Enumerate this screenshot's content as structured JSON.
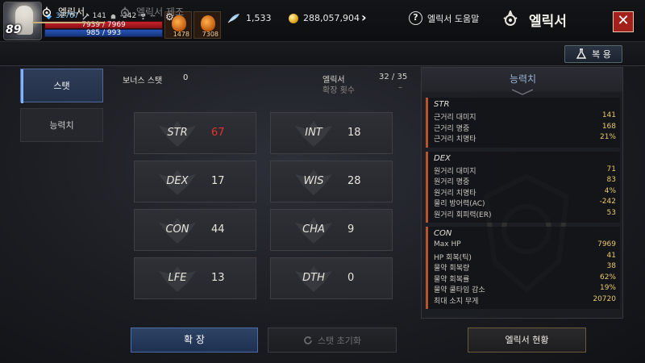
{
  "player": {
    "level": "89",
    "combat_power": "32767",
    "sword_stat": "141",
    "helmet_stat": "-242",
    "trophy_stat": "--",
    "hp_text": "7939 / 7969",
    "mp_text": "985 / 993",
    "hp_fraction": 0.996,
    "mp_fraction": 0.992
  },
  "quick_slots": [
    {
      "icon": "potion-icon",
      "count": "1478"
    },
    {
      "icon": "potion-icon",
      "count": "7308"
    }
  ],
  "currency": {
    "feather": "1,533",
    "gold": "288,057,904"
  },
  "header": {
    "help_label": "엘릭서 도움말",
    "title": "엘릭서",
    "close_glyph": "✕"
  },
  "tabs": {
    "elixir": "엘릭서",
    "craft": "엘릭서 제조",
    "restore": "복 용"
  },
  "side_tabs": {
    "stat": "스탯",
    "ability": "능력치"
  },
  "summary": {
    "bonus_label": "보너스 스탯",
    "bonus_value": "0",
    "elixir_label": "엘릭서",
    "elixir_value": "32 / 35",
    "expand_count_label": "확장 횟수",
    "expand_count_value": "–"
  },
  "stats": [
    {
      "name": "STR",
      "value": "67",
      "highlight": true
    },
    {
      "name": "INT",
      "value": "18",
      "highlight": false
    },
    {
      "name": "DEX",
      "value": "17",
      "highlight": false
    },
    {
      "name": "WIS",
      "value": "28",
      "highlight": false
    },
    {
      "name": "CON",
      "value": "44",
      "highlight": false
    },
    {
      "name": "CHA",
      "value": "9",
      "highlight": false
    },
    {
      "name": "LFE",
      "value": "13",
      "highlight": false
    },
    {
      "name": "DTH",
      "value": "0",
      "highlight": false
    }
  ],
  "ability_panel": {
    "title": "능력치",
    "groups": [
      {
        "title": "STR",
        "rows": [
          {
            "label": "근거리 대미지",
            "value": "141"
          },
          {
            "label": "근거리 명중",
            "value": "168"
          },
          {
            "label": "근거리 치명타",
            "value": "21%"
          }
        ]
      },
      {
        "title": "DEX",
        "rows": [
          {
            "label": "원거리 대미지",
            "value": "71"
          },
          {
            "label": "원거리 명중",
            "value": "83"
          },
          {
            "label": "원거리 치명타",
            "value": "4%"
          },
          {
            "label": "물리 방어력(AC)",
            "value": "-242"
          },
          {
            "label": "원거리 회피력(ER)",
            "value": "53"
          }
        ]
      },
      {
        "title": "CON",
        "rows": [
          {
            "label": "Max HP",
            "value": "7969"
          },
          {
            "label": "HP 회복(틱)",
            "value": "41"
          },
          {
            "label": "물약 회복량",
            "value": "38"
          },
          {
            "label": "물약 회복률",
            "value": "62%"
          },
          {
            "label": "물약 쿨타임 감소",
            "value": "19%"
          },
          {
            "label": "최대 소지 무게",
            "value": "20720"
          }
        ]
      }
    ]
  },
  "buttons": {
    "expand": "확 장",
    "reset": "스탯 초기화",
    "status": "엘릭서 현황"
  },
  "colors": {
    "accent_red": "#e8302a",
    "value_gold": "#e8c96a",
    "group_accent": "#b7542a",
    "hp": "#c8222a",
    "mp": "#2753b8",
    "close_red": "#a3201b"
  }
}
